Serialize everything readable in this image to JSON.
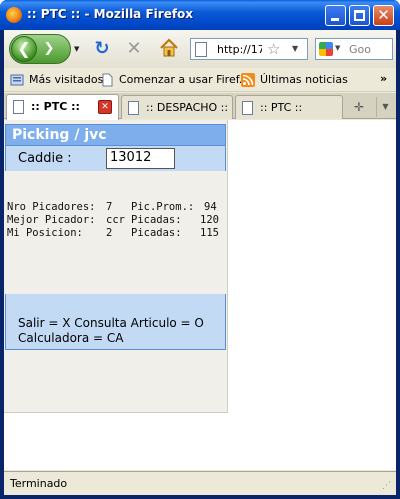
{
  "window": {
    "title": ":: PTC :: - Mozilla Firefox"
  },
  "navbar": {
    "url": "http://17",
    "search_placeholder": "Goo"
  },
  "bookmarks": {
    "items": [
      {
        "label": "Más visitados",
        "icon": "bookmarks-folder-icon"
      },
      {
        "label": "Comenzar a usar Firef...",
        "icon": "page-icon"
      },
      {
        "label": "Últimas noticias",
        "icon": "rss-feed-icon"
      }
    ],
    "more": "»"
  },
  "tabs": [
    {
      "label": ":: PTC ::",
      "active": true
    },
    {
      "label": ":: DESPACHO ::",
      "active": false
    },
    {
      "label": ":: PTC ::",
      "active": false
    }
  ],
  "app": {
    "header": "Picking / jvc",
    "caddie_label": "Caddie :",
    "caddie_value": "13012",
    "stats": [
      {
        "label": "Nro Picadores:",
        "value": "7",
        "label2": "Pic.Prom.:",
        "value2": "94"
      },
      {
        "label": "Mejor Picador:",
        "value": "ccr",
        "label2": "Picadas:",
        "value2": "120"
      },
      {
        "label": "Mi Posicion:",
        "value": "2",
        "label2": "Picadas:",
        "value2": "115"
      }
    ],
    "footer_line1": "Salir = X Consulta Articulo = O",
    "footer_line2": "Calculadora = CA"
  },
  "status": {
    "text": "Terminado"
  },
  "colors": {
    "header_bg": "#7eaeeb",
    "panel_bg": "#c3daf5",
    "titlebar": "#0a5ad7"
  }
}
